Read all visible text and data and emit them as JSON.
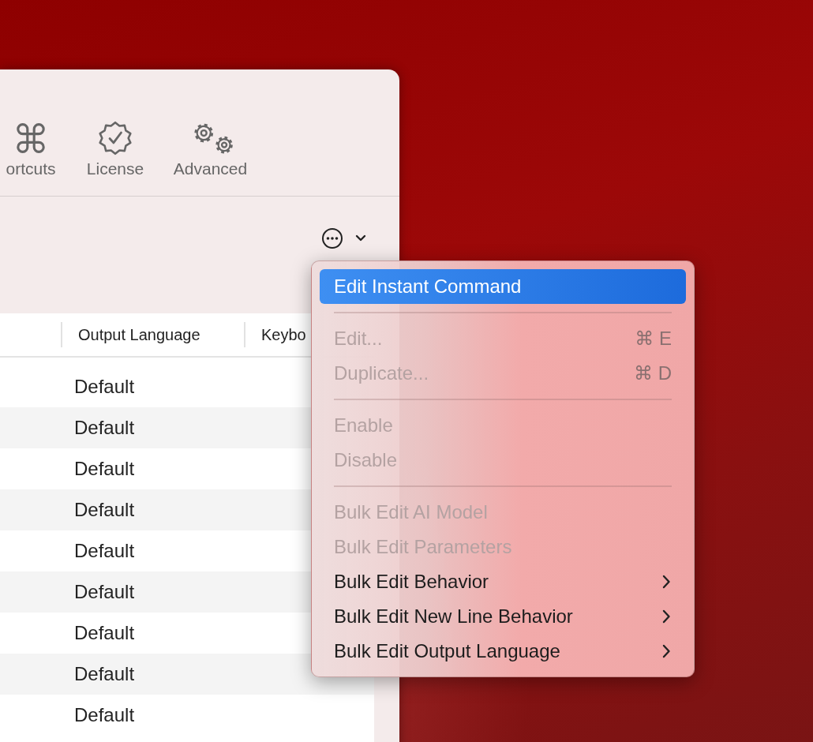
{
  "toolbar": [
    {
      "kind": "command",
      "label": "ortcuts"
    },
    {
      "kind": "badge",
      "label": "License"
    },
    {
      "kind": "gears",
      "label": "Advanced"
    }
  ],
  "table": {
    "columns": [
      "",
      "Output Language",
      "Keybo"
    ],
    "rows": [
      {
        "output_language": "Default"
      },
      {
        "output_language": "Default"
      },
      {
        "output_language": "Default"
      },
      {
        "output_language": "Default"
      },
      {
        "output_language": "Default"
      },
      {
        "output_language": "Default"
      },
      {
        "output_language": "Default"
      },
      {
        "output_language": "Default"
      },
      {
        "output_language": "Default"
      }
    ]
  },
  "menu": {
    "items": [
      {
        "kind": "item",
        "label": "Edit Instant Command",
        "selected": true,
        "disabled": false,
        "submenu": false
      },
      {
        "kind": "separator"
      },
      {
        "kind": "item",
        "label": "Edit...",
        "shortcut": "⌘ E",
        "selected": false,
        "disabled": true,
        "submenu": false
      },
      {
        "kind": "item",
        "label": "Duplicate...",
        "shortcut": "⌘ D",
        "selected": false,
        "disabled": true,
        "submenu": false
      },
      {
        "kind": "separator"
      },
      {
        "kind": "item",
        "label": "Enable",
        "selected": false,
        "disabled": true,
        "submenu": false
      },
      {
        "kind": "item",
        "label": "Disable",
        "selected": false,
        "disabled": true,
        "submenu": false
      },
      {
        "kind": "separator"
      },
      {
        "kind": "item",
        "label": "Bulk Edit AI Model",
        "selected": false,
        "disabled": true,
        "submenu": false
      },
      {
        "kind": "item",
        "label": "Bulk Edit Parameters",
        "selected": false,
        "disabled": true,
        "submenu": false
      },
      {
        "kind": "item",
        "label": "Bulk Edit Behavior",
        "selected": false,
        "disabled": false,
        "submenu": true
      },
      {
        "kind": "item",
        "label": "Bulk Edit New Line Behavior",
        "selected": false,
        "disabled": false,
        "submenu": true
      },
      {
        "kind": "item",
        "label": "Bulk Edit Output Language",
        "selected": false,
        "disabled": false,
        "submenu": true
      }
    ]
  }
}
